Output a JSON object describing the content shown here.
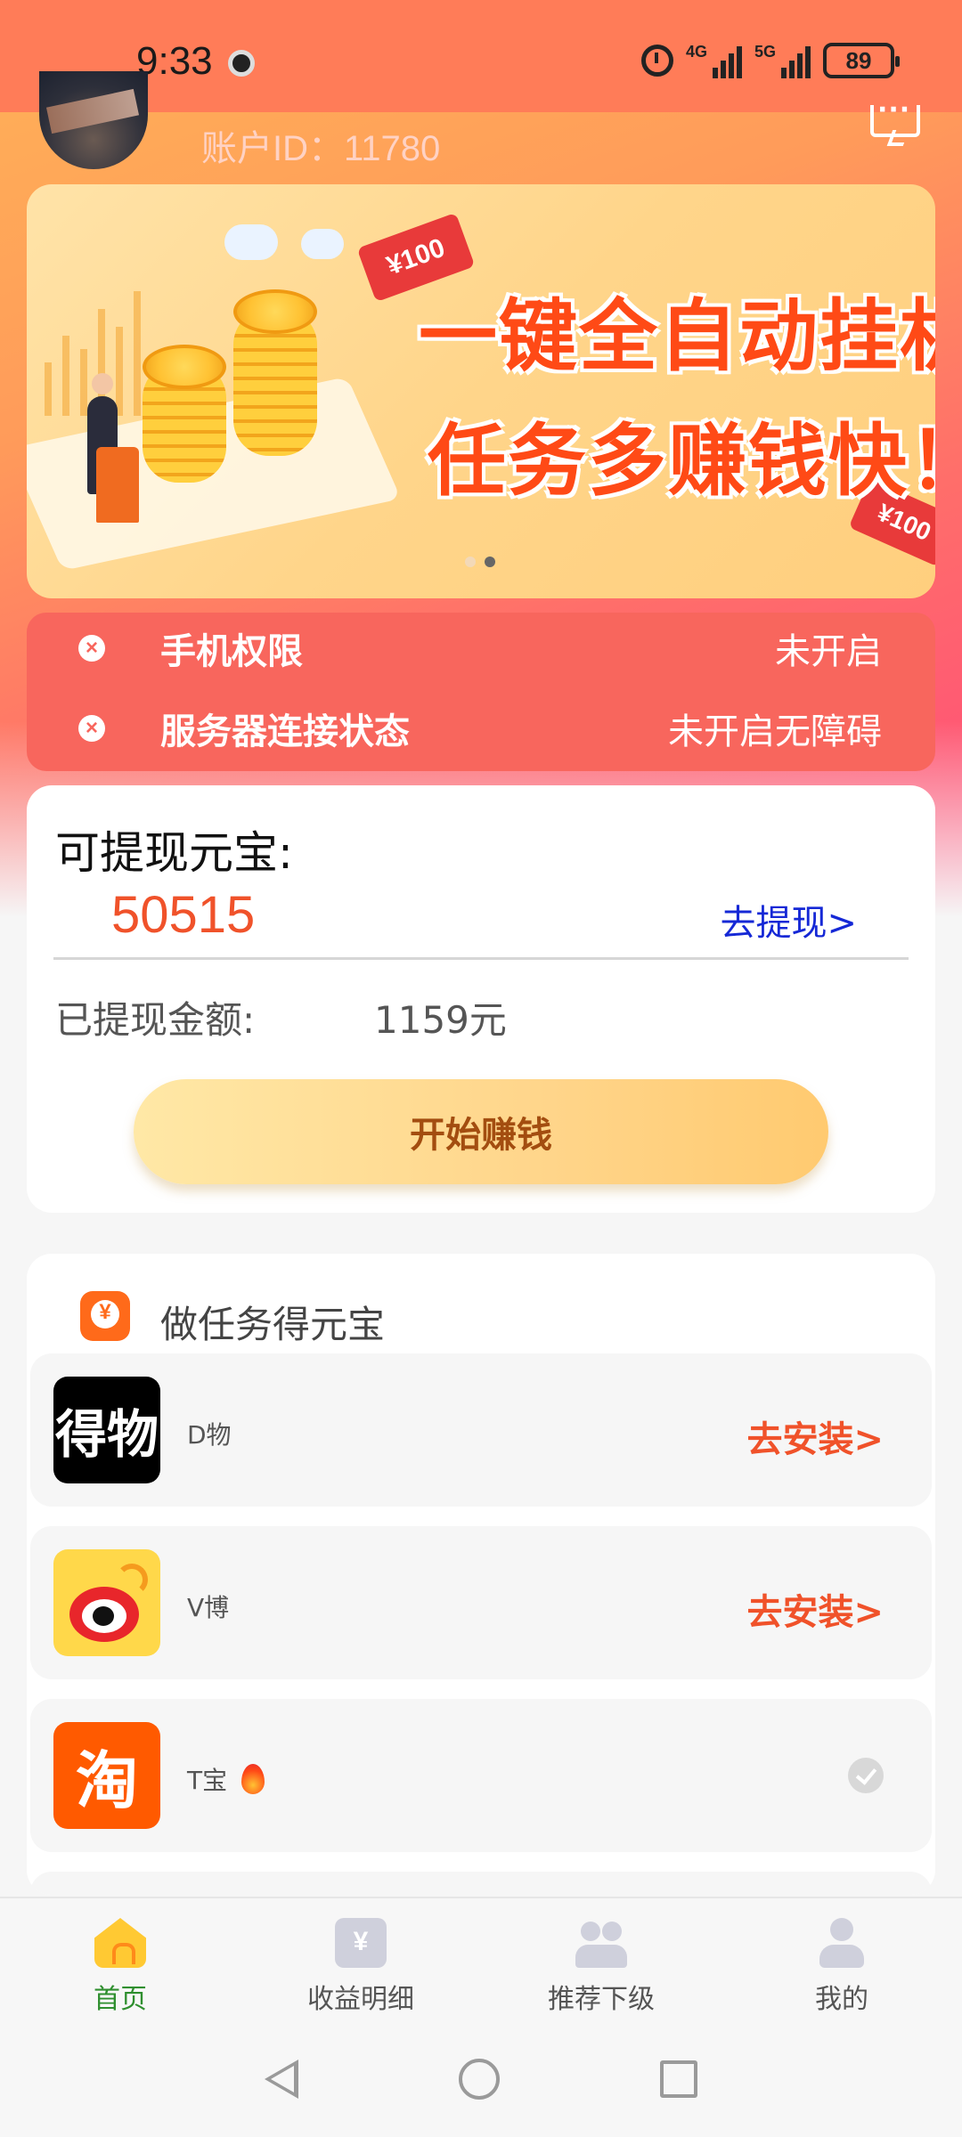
{
  "status_bar": {
    "time": "9:33",
    "network1": "4G",
    "network2": "5G",
    "battery": "89"
  },
  "profile": {
    "account_id": "账户ID：11780"
  },
  "banner": {
    "line1": "一键全自动挂机",
    "line2": "任务多赚钱快！",
    "ticket1": "¥100",
    "ticket2": "¥100"
  },
  "permissions": [
    {
      "label": "手机权限",
      "value": "未开启"
    },
    {
      "label": "服务器连接状态",
      "value": "未开启无障碍"
    }
  ],
  "wallet": {
    "title": "可提现元宝:",
    "amount": "50515",
    "withdraw_link": "去提现>",
    "withdrawn_label": "已提现金额:",
    "withdrawn_value": "1159元",
    "start_button": "开始赚钱"
  },
  "tasks": {
    "title": "做任务得元宝",
    "items": [
      {
        "logo_text": "得物",
        "name": "D物",
        "action": "去安装>"
      },
      {
        "name": "V博",
        "action": "去安装>"
      },
      {
        "logo_text": "淘",
        "name": "T宝",
        "status": "done"
      }
    ]
  },
  "bottom_nav": [
    {
      "label": "首页",
      "icon": "home-icon",
      "active": true
    },
    {
      "label": "收益明细",
      "icon": "earnings-icon"
    },
    {
      "label": "推荐下级",
      "icon": "referral-icon"
    },
    {
      "label": "我的",
      "icon": "profile-icon"
    }
  ],
  "colors": {
    "accent": "#ff7c58",
    "amount": "#f0522a",
    "link": "#1528d6",
    "active_nav": "#2f8f2f"
  }
}
